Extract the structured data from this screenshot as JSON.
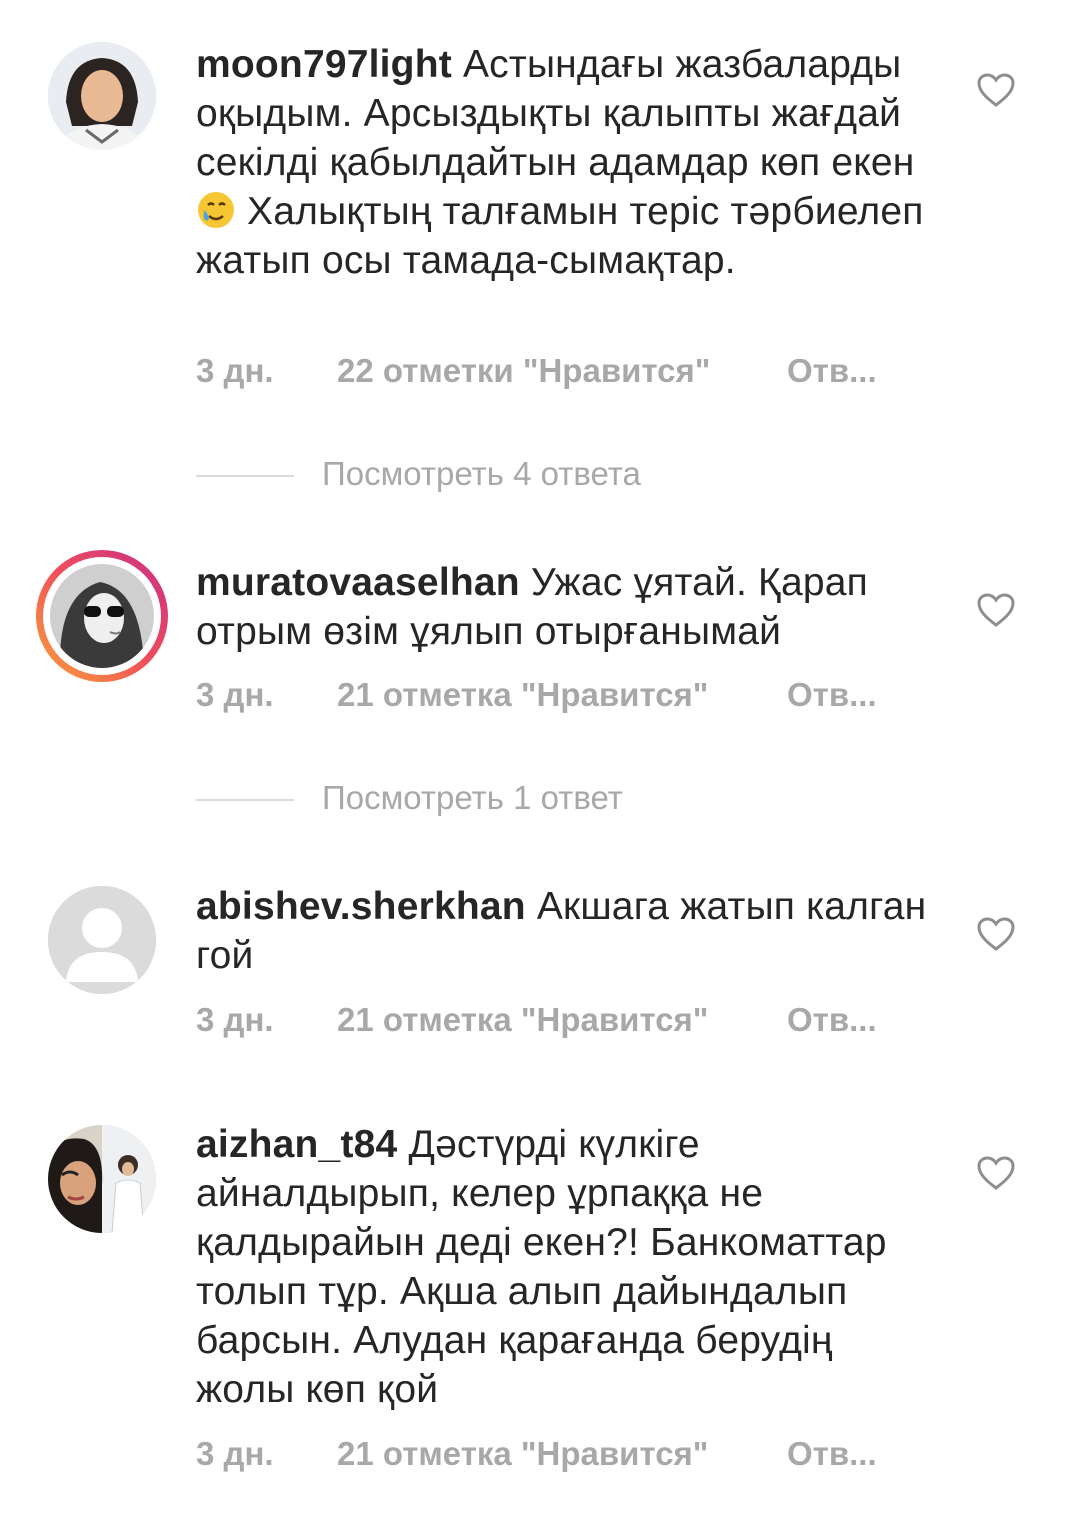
{
  "comments": [
    {
      "username": "moon797light",
      "text": "Астындағы жазбаларды оқыдым. Арсыздықты қалыпты жағдай секілді қабылдайтын адамдар көп екен",
      "text_after_emoji": "Халықтың талғамын теріс тәрбиелеп жатып осы тамада-сымақтар.",
      "emoji": "smiling-face-with-tear",
      "time": "3 дн.",
      "likes": "22 отметки \"Нравится\"",
      "reply": "Отв...",
      "view_replies": "Посмотреть 4 ответа"
    },
    {
      "username": "muratovaaselhan",
      "text": "Ужас ұятай. Қарап отрым өзім ұялып отырғанымай",
      "time": "3 дн.",
      "likes": "21 отметка \"Нравится\"",
      "reply": "Отв...",
      "view_replies": "Посмотреть 1 ответ"
    },
    {
      "username": "abishev.sherkhan",
      "text": "Акшага жатып калган гой",
      "time": "3 дн.",
      "likes": "21 отметка \"Нравится\"",
      "reply": "Отв..."
    },
    {
      "username": "aizhan_t84",
      "text": "Дәстүрді күлкіге айналдырып, келер ұрпаққа не қалдырайын деді екен?! Банкоматтар толып тұр. Ақша алып дайындалып барсын. Алудан қарағанда берудің жолы көп қой",
      "time": "3 дн.",
      "likes": "21 отметка \"Нравится\"",
      "reply": "Отв..."
    }
  ],
  "colors": {
    "text": "#262626",
    "secondary": "#a8a8a8",
    "divider": "#dbdbdb",
    "story_ring_start": "#f9a43a",
    "story_ring_end": "#c72e8a"
  }
}
